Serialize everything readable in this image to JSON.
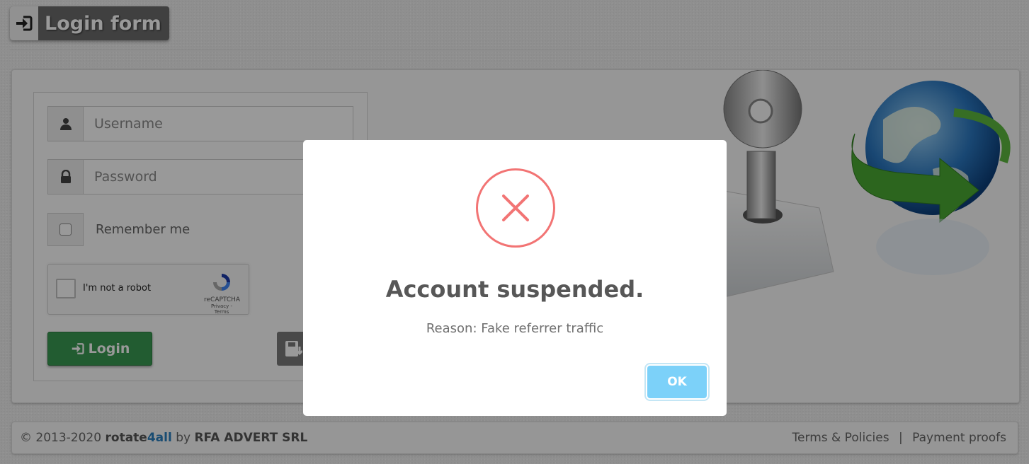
{
  "header": {
    "title": "Login form",
    "icon": "sign-in-icon"
  },
  "login_form": {
    "username_placeholder": "Username",
    "password_placeholder": "Password",
    "remember_label": "Remember me",
    "recaptcha": {
      "label": "I'm not a robot",
      "brand": "reCAPTCHA",
      "terms": "Privacy - Terms"
    },
    "login_button": "Login"
  },
  "footer": {
    "copyright": "© 2013-2020",
    "brand_part1": "r",
    "brand_o": "o",
    "brand_part2": "tate",
    "brand_part3": "4all",
    "by": "by",
    "company": "RFA ADVERT SRL",
    "links": [
      "Terms & Policies",
      "Payment proofs"
    ],
    "link_separator": "|"
  },
  "modal": {
    "icon": "error-x-icon",
    "title": "Account suspended.",
    "message": "Reason: Fake referrer traffic",
    "ok_label": "OK"
  },
  "colors": {
    "login_button": "#3a9a52",
    "error": "#f27474",
    "ok_button": "#7cd1f9",
    "brand_accent": "#2b7fbf"
  }
}
